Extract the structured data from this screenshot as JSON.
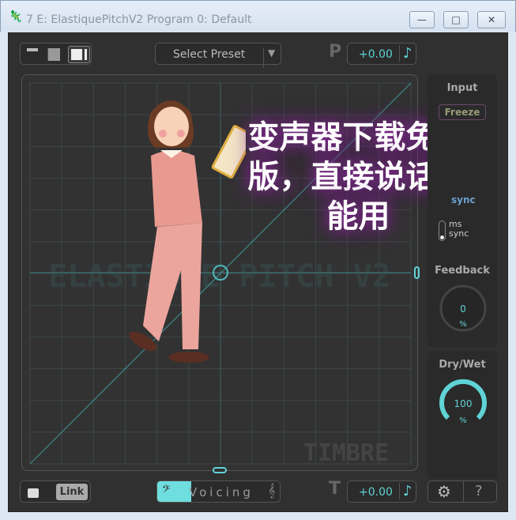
{
  "window": {
    "title": "7 E: ElastiquePitchV2 Program 0: Default",
    "minimize": "—",
    "maximize": "□",
    "close": "✕"
  },
  "toolbar": {
    "preset_label": "Select Preset",
    "preset_arrow": "▼",
    "pitch_letter": "P",
    "pitch_value": "+0.00",
    "note_icon": "♪"
  },
  "graph": {
    "watermark": "ELASTIQUE PITCH V2",
    "mode_label": "TIMBRE"
  },
  "side": {
    "input_label": "Input",
    "freeze_label": "Freeze",
    "sync_label": "sync",
    "toggle_ms": "ms",
    "toggle_sync": "sync",
    "feedback_label": "Feedback",
    "feedback_value": "0",
    "feedback_unit": "%",
    "feedback_level": 0,
    "drywet_label": "Dry/Wet",
    "drywet_value": "100",
    "drywet_unit": "%",
    "drywet_level": 100
  },
  "bottom": {
    "link_label": "Link",
    "voicing_label": "Voicing",
    "voicing_level": 0.28,
    "timbre_letter": "T",
    "timbre_value": "+0.00",
    "note_icon": "♪",
    "settings_icon": "⚙",
    "help_label": "?"
  },
  "overlay": {
    "line1": "变声器下载免费",
    "line2": "版，直接说话就",
    "line3": "能用"
  },
  "colors": {
    "accent": "#5fd3d6",
    "bg": "#303030",
    "overlay_glow": "#8a2a9a"
  }
}
